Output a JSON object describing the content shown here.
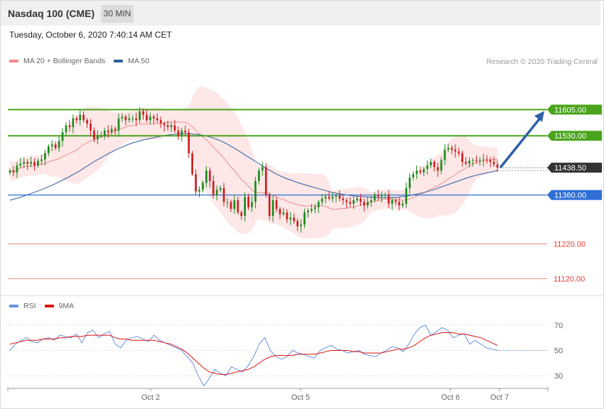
{
  "header": {
    "instrument": "Nasdaq 100 (CME)",
    "timeframe": "30 MIN",
    "datetime": "Tuesday, October 6, 2020 7:40:14 AM CET"
  },
  "legend": {
    "bollinger_label": "MA 20 + Bollinger Bands",
    "ma50_label": "MA 50",
    "copyright": "Research © 2020 Trading Central"
  },
  "rsi_legend": {
    "rsi_label": "RSI",
    "ma_label": "9MA"
  },
  "colors": {
    "resistance": "#4aa51c",
    "support": "#2f6fd6",
    "last_price": "#333333",
    "lower_levels": "#e53935",
    "arrow": "#2f5fa8",
    "candle_up": "#1f8a1f",
    "candle_down": "#cc1f1f",
    "ma20": "#e87a7a",
    "bollinger_fill": "#fde3e3",
    "ma50": "#2c5d9f",
    "rsi": "#6a8fe0",
    "rsi_ma": "#dd1111"
  },
  "chart_data": [
    {
      "type": "candlestick",
      "title": "Nasdaq 100 (CME)",
      "timeframe": "30 MIN",
      "x_labels": [
        "Oct 2",
        "Oct 5",
        "Oct 6",
        "Oct 7"
      ],
      "ylim": [
        11080,
        11720
      ],
      "levels": [
        {
          "value": 11605.0,
          "label": "11605.00",
          "kind": "resistance"
        },
        {
          "value": 11530.0,
          "label": "11530.00",
          "kind": "resistance"
        },
        {
          "value": 11438.5,
          "label": "11438.50",
          "kind": "last"
        },
        {
          "value": 11360.0,
          "label": "11360.00",
          "kind": "support"
        },
        {
          "value": 11220.0,
          "label": "11220.00",
          "kind": "target"
        },
        {
          "value": 11120.0,
          "label": "11120.00",
          "kind": "target"
        }
      ],
      "close": [
        11430,
        11425,
        11445,
        11450,
        11455,
        11450,
        11455,
        11445,
        11458,
        11462,
        11480,
        11500,
        11505,
        11495,
        11515,
        11540,
        11560,
        11555,
        11580,
        11575,
        11590,
        11575,
        11565,
        11545,
        11520,
        11530,
        11530,
        11545,
        11540,
        11550,
        11545,
        11580,
        11585,
        11575,
        11580,
        11580,
        11575,
        11600,
        11590,
        11575,
        11585,
        11580,
        11575,
        11565,
        11560,
        11555,
        11560,
        11545,
        11530,
        11545,
        11540,
        11480,
        11420,
        11370,
        11375,
        11395,
        11430,
        11400,
        11360,
        11375,
        11380,
        11340,
        11340,
        11320,
        11345,
        11310,
        11300,
        11355,
        11325,
        11340,
        11400,
        11430,
        11440,
        11360,
        11300,
        11345,
        11320,
        11305,
        11310,
        11290,
        11295,
        11285,
        11270,
        11275,
        11310,
        11315,
        11320,
        11325,
        11340,
        11350,
        11355,
        11350,
        11355,
        11358,
        11350,
        11345,
        11340,
        11335,
        11345,
        11350,
        11340,
        11330,
        11340,
        11345,
        11360,
        11355,
        11358,
        11360,
        11335,
        11345,
        11340,
        11330,
        11335,
        11380,
        11410,
        11420,
        11430,
        11425,
        11435,
        11445,
        11455,
        11440,
        11430,
        11460,
        11490,
        11495,
        11490,
        11485,
        11480,
        11455,
        11450,
        11458,
        11460,
        11458,
        11460,
        11462,
        11460,
        11455,
        11448,
        11438.5
      ],
      "ma50": [
        11345,
        11349,
        11353,
        11358,
        11363,
        11368,
        11373,
        11379,
        11385,
        11391,
        11398,
        11405,
        11412,
        11420,
        11428,
        11437,
        11446,
        11455,
        11463,
        11471,
        11479,
        11486,
        11493,
        11499,
        11505,
        11510,
        11514,
        11518,
        11521,
        11524,
        11527,
        11530,
        11532,
        11534,
        11535,
        11536,
        11536,
        11535,
        11534,
        11532,
        11529,
        11525,
        11520,
        11514,
        11507,
        11499,
        11491,
        11482,
        11473,
        11464,
        11455,
        11446,
        11437,
        11429,
        11421,
        11414,
        11408,
        11403,
        11398,
        11393,
        11389,
        11385,
        11381,
        11377,
        11373,
        11369,
        11366,
        11363,
        11361,
        11359,
        11357,
        11356,
        11355,
        11354,
        11353,
        11352,
        11352,
        11352,
        11353,
        11354,
        11356,
        11358,
        11361,
        11364,
        11367,
        11371,
        11375,
        11380,
        11385,
        11390,
        11395,
        11400,
        11405,
        11410,
        11414,
        11418,
        11421,
        11424,
        11427,
        11430
      ]
    },
    {
      "type": "line",
      "title": "RSI",
      "ylim": [
        20,
        80
      ],
      "ticks": [
        30,
        50,
        70
      ],
      "series": [
        {
          "name": "RSI",
          "values": [
            50,
            55,
            58,
            60,
            57,
            56,
            59,
            60,
            58,
            62,
            61,
            60,
            63,
            56,
            64,
            66,
            60,
            63,
            65,
            55,
            52,
            58,
            60,
            61,
            59,
            57,
            62,
            58,
            56,
            54,
            52,
            50,
            45,
            40,
            30,
            22,
            28,
            35,
            32,
            30,
            37,
            35,
            33,
            38,
            45,
            55,
            60,
            50,
            45,
            43,
            45,
            50,
            48,
            47,
            45,
            44,
            50,
            52,
            54,
            51,
            50,
            48,
            49,
            50,
            47,
            46,
            45,
            48,
            50,
            53,
            52,
            49,
            55,
            63,
            68,
            70,
            62,
            65,
            68,
            66,
            60,
            62,
            63,
            55,
            58,
            55,
            52,
            51,
            50
          ]
        },
        {
          "name": "9MA",
          "values": [
            55,
            56,
            57,
            58,
            58,
            58,
            59,
            59,
            59,
            60,
            60,
            61,
            61,
            61,
            62,
            62,
            62,
            62,
            62,
            60,
            59,
            59,
            58,
            58,
            58,
            58,
            58,
            57,
            56,
            55,
            53,
            51,
            48,
            44,
            40,
            36,
            33,
            32,
            31,
            31,
            32,
            33,
            34,
            35,
            37,
            40,
            43,
            45,
            46,
            46,
            46,
            46,
            47,
            47,
            47,
            47,
            48,
            49,
            50,
            50,
            50,
            50,
            49,
            49,
            48,
            48,
            48,
            48,
            49,
            50,
            51,
            51,
            52,
            54,
            57,
            60,
            62,
            63,
            64,
            64,
            64,
            63,
            63,
            62,
            61,
            60,
            58,
            56,
            54
          ]
        }
      ]
    }
  ]
}
